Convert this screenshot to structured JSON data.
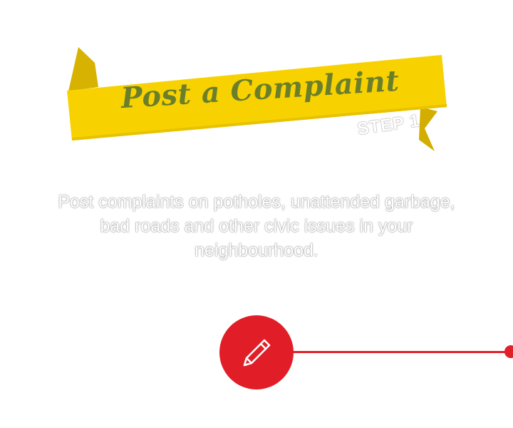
{
  "banner": {
    "title": "Post a Complaint",
    "step_label": "STEP 1"
  },
  "description": {
    "text": "Post complaints on potholes, unattended garbage, bad roads and other civic issues in your neighbourhood."
  },
  "action": {
    "icon": "pencil-icon"
  },
  "colors": {
    "ribbon_yellow": "#f8d200",
    "ribbon_fold": "#d6b000",
    "title_green": "#6b7f2a",
    "accent_red": "#e11e27"
  }
}
